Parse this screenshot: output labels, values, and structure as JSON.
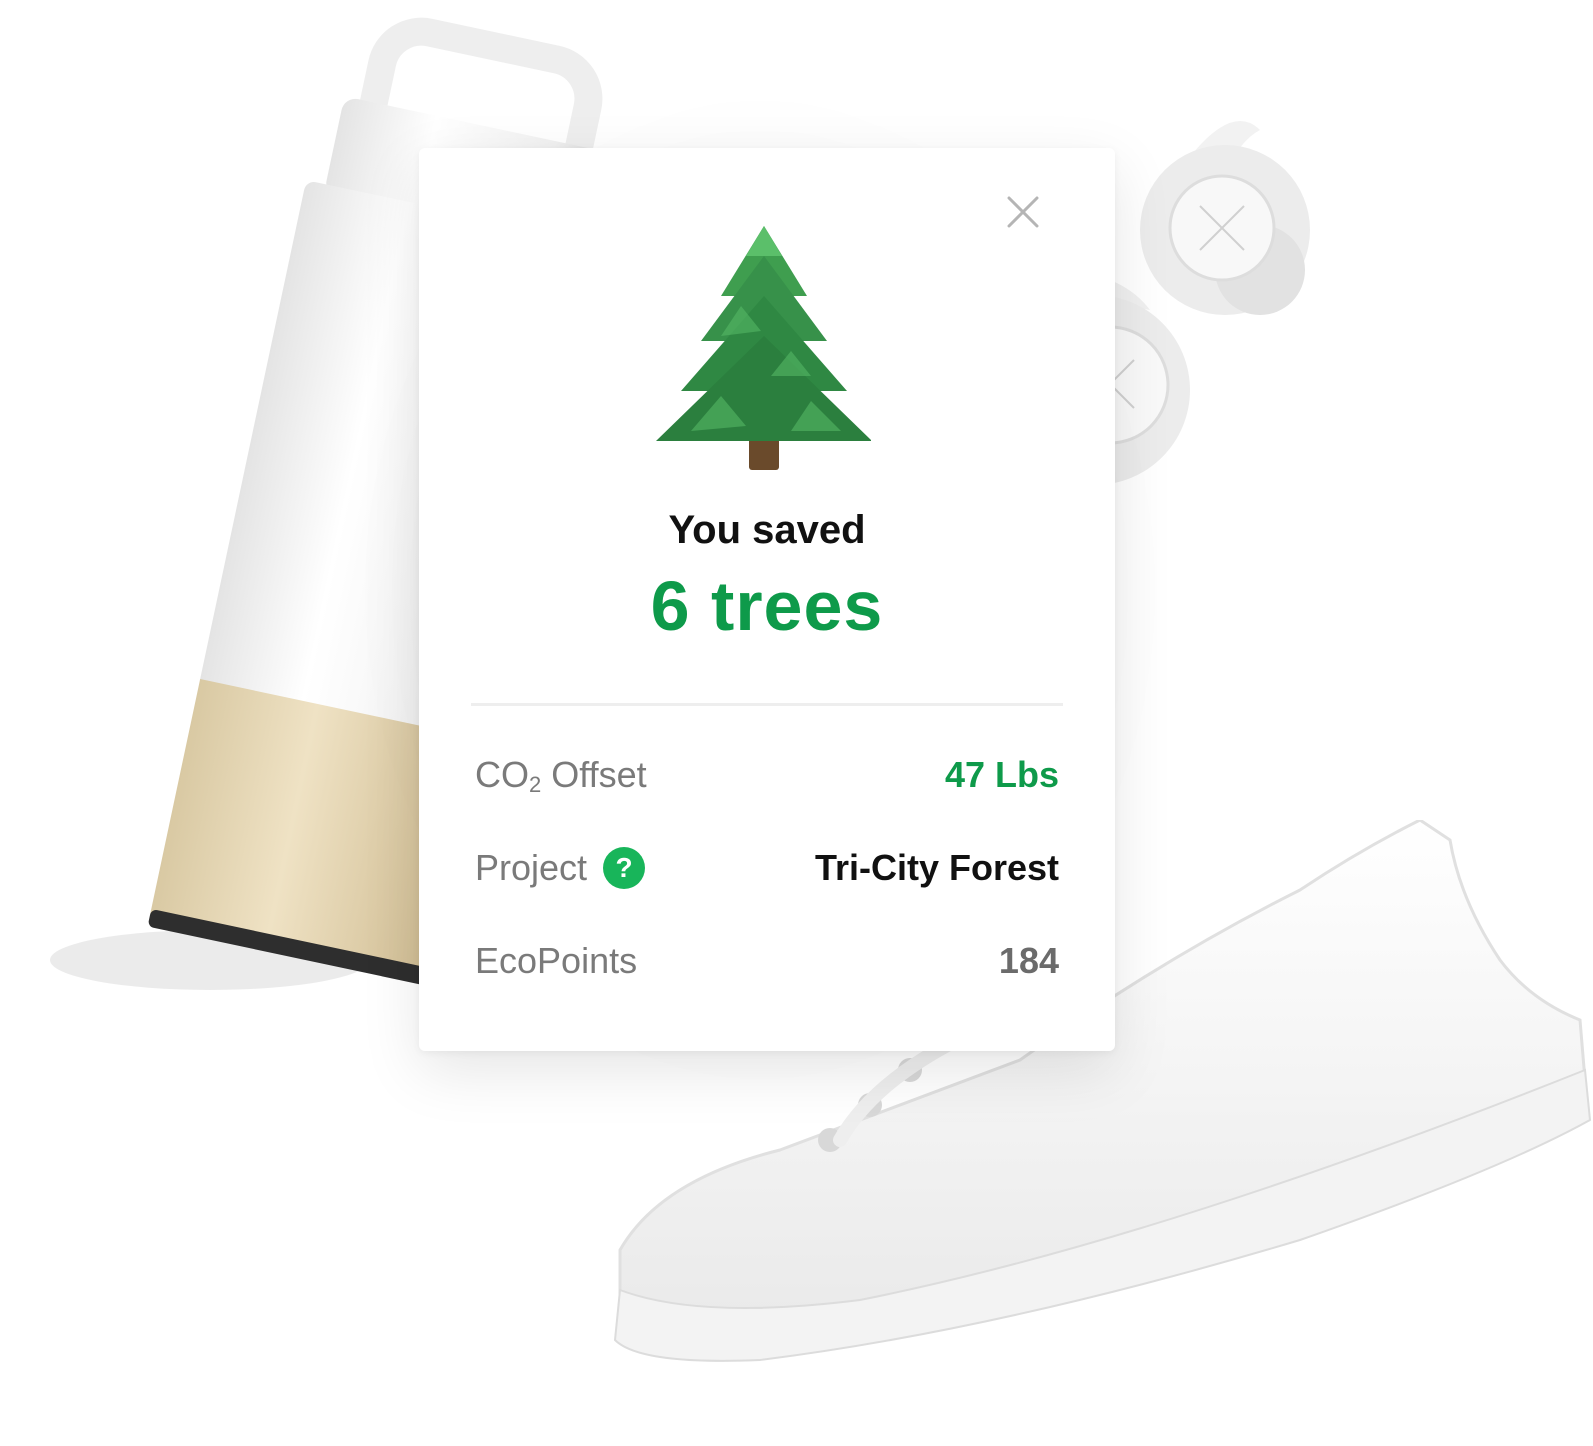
{
  "popup": {
    "saved_label": "You saved",
    "trees_count": "6 trees",
    "rows": [
      {
        "label_main": "CO",
        "label_sub": "2",
        "label_rest": " Offset",
        "value": "47 Lbs",
        "value_color": "#0e9a4a"
      },
      {
        "label": "Project",
        "value": "Tri-City Forest",
        "value_color": "#111111",
        "help_icon_text": "?"
      },
      {
        "label": "EcoPoints",
        "value": "184",
        "value_color": "#6b6b6b"
      }
    ],
    "icons": {
      "close": "close-icon",
      "tree": "evergreen-tree-icon",
      "help": "question-circle-icon"
    }
  },
  "colors": {
    "accent_green": "#0e9a4a",
    "help_green": "#18b55a"
  }
}
